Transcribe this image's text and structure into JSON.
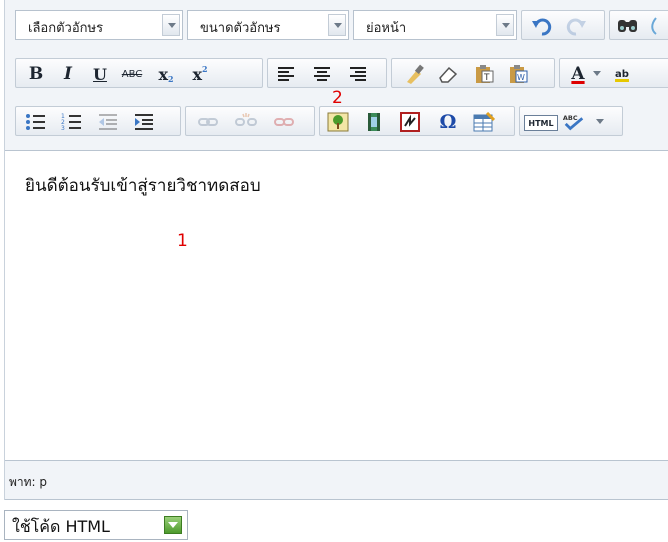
{
  "toolbar": {
    "font_family": {
      "value": "เลือกตัวอักษร"
    },
    "font_size": {
      "value": "ขนาดตัวอักษร"
    },
    "paragraph_format": {
      "value": "ย่อหน้า"
    },
    "row2": {
      "bold": "B",
      "italic": "I",
      "underline": "U",
      "strike": "ABC",
      "subscript": "x",
      "superscript": "x",
      "text_color": "A",
      "highlight": "ab"
    },
    "row3": {
      "html_source": "HTML"
    }
  },
  "content": {
    "text": "ยินดีต้อนรับเข้าสู่รายวิชาทดสอบ",
    "marker_1": "1",
    "marker_2": "2"
  },
  "status": {
    "path": "พาท: p"
  },
  "html_mode": {
    "label": "ใช้โค้ด HTML"
  },
  "icons": [
    "undo-icon",
    "redo-icon",
    "find-icon",
    "bold-icon",
    "italic-icon",
    "underline-icon",
    "strikethrough-icon",
    "subscript-icon",
    "superscript-icon",
    "align-left-icon",
    "align-center-icon",
    "align-right-icon",
    "cleanup-icon",
    "eraser-icon",
    "paste-text-icon",
    "paste-word-icon",
    "text-color-icon",
    "highlight-icon",
    "unordered-list-icon",
    "ordered-list-icon",
    "outdent-icon",
    "indent-icon",
    "link-icon",
    "unlink-icon",
    "anchor-icon",
    "insert-image-icon",
    "insert-media-icon",
    "nolink-icon",
    "special-char-icon",
    "table-icon",
    "html-source-icon",
    "spellcheck-icon"
  ],
  "colors": {
    "toolbar_bg": "#f1f4f8",
    "marker_red": "#e00000",
    "border": "#b9c4d0"
  }
}
